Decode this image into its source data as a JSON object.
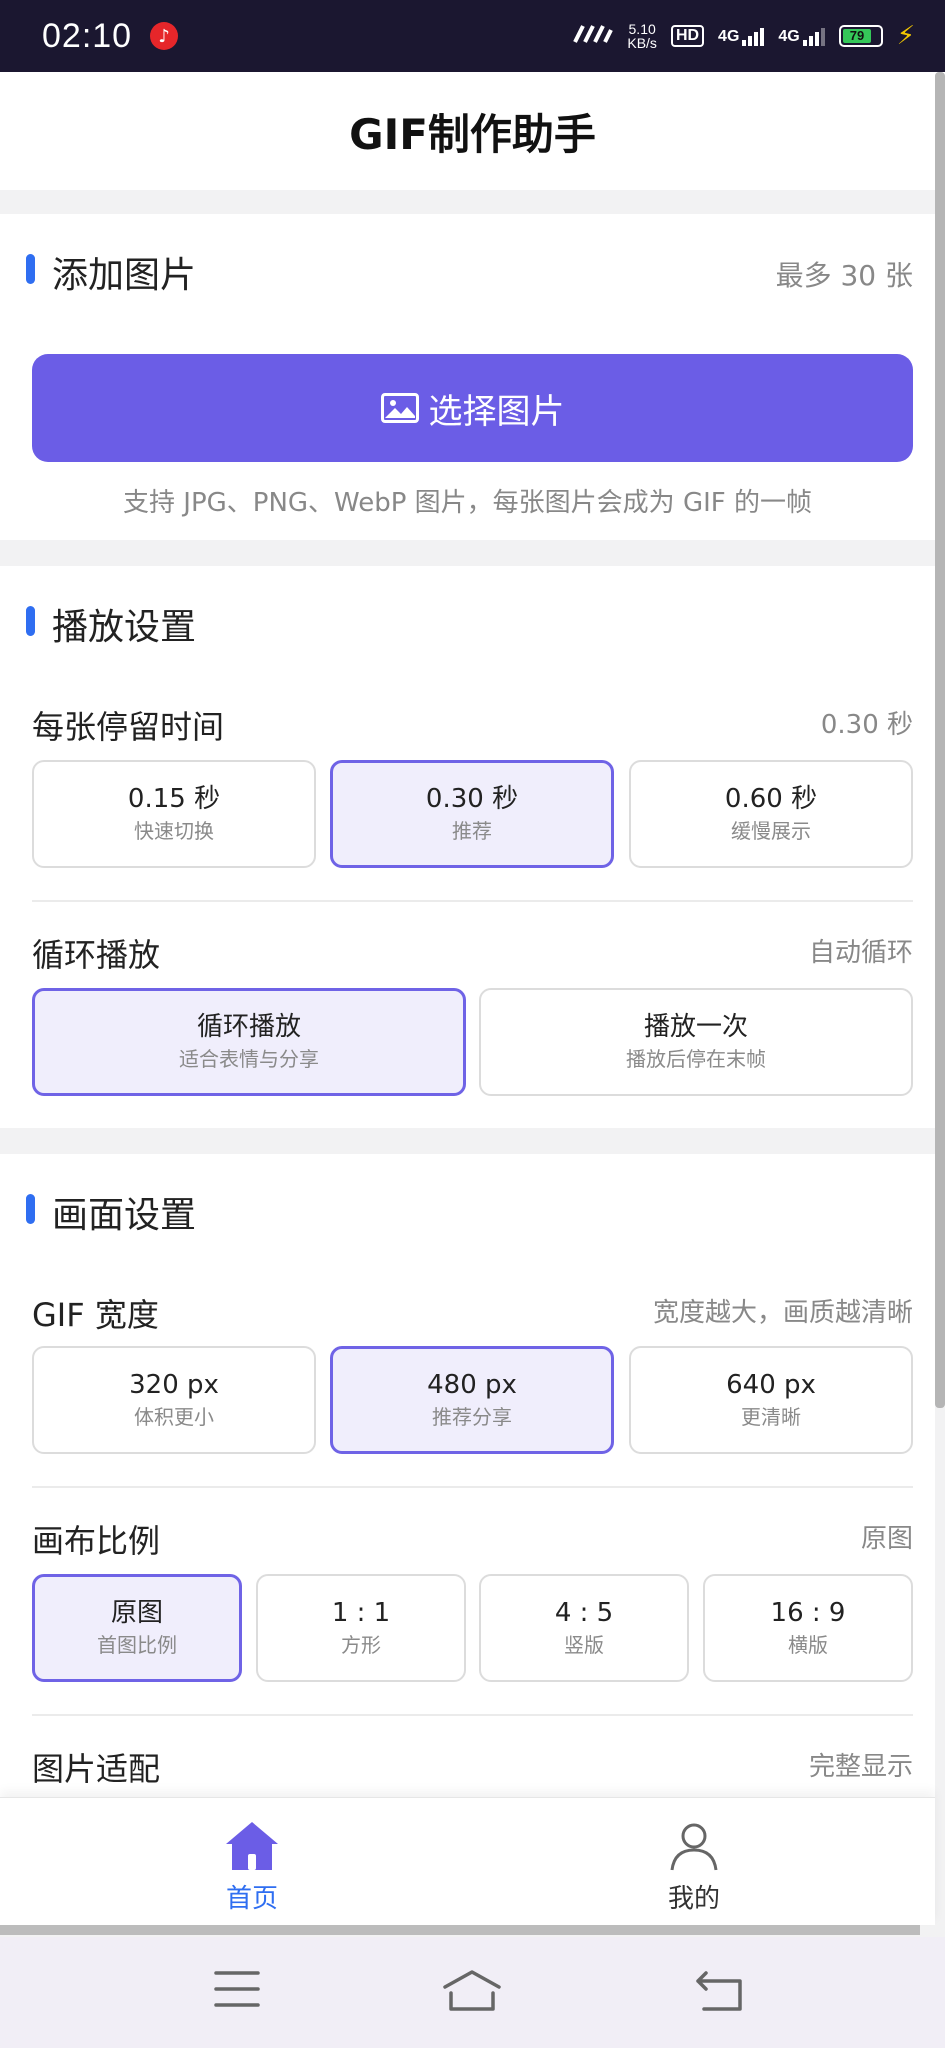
{
  "status_bar": {
    "time": "02:10",
    "net_speed": "5.10",
    "net_speed_unit": "KB/s",
    "hd_label": "HD",
    "signal1": "4G",
    "signal2": "4G",
    "battery": "79"
  },
  "header": {
    "title": "GIF制作助手"
  },
  "add_images": {
    "title": "添加图片",
    "hint": "最多 30 张",
    "button_label": "选择图片",
    "support_text": "支持 JPG、PNG、WebP 图片，每张图片会成为 GIF 的一帧"
  },
  "playback": {
    "title": "播放设置",
    "duration": {
      "label": "每张停留时间",
      "value": "0.30 秒",
      "options": [
        {
          "main": "0.15 秒",
          "sub": "快速切换",
          "selected": false
        },
        {
          "main": "0.30 秒",
          "sub": "推荐",
          "selected": true
        },
        {
          "main": "0.60 秒",
          "sub": "缓慢展示",
          "selected": false
        }
      ]
    },
    "loop": {
      "label": "循环播放",
      "value": "自动循环",
      "options": [
        {
          "main": "循环播放",
          "sub": "适合表情与分享",
          "selected": true
        },
        {
          "main": "播放一次",
          "sub": "播放后停在末帧",
          "selected": false
        }
      ]
    }
  },
  "canvas": {
    "title": "画面设置",
    "width": {
      "label": "GIF 宽度",
      "value": "宽度越大，画质越清晰",
      "options": [
        {
          "main": "320 px",
          "sub": "体积更小",
          "selected": false
        },
        {
          "main": "480 px",
          "sub": "推荐分享",
          "selected": true
        },
        {
          "main": "640 px",
          "sub": "更清晰",
          "selected": false
        }
      ]
    },
    "ratio": {
      "label": "画布比例",
      "value": "原图",
      "options": [
        {
          "main": "原图",
          "sub": "首图比例",
          "selected": true
        },
        {
          "main": "1 : 1",
          "sub": "方形",
          "selected": false
        },
        {
          "main": "4 : 5",
          "sub": "竖版",
          "selected": false
        },
        {
          "main": "16 : 9",
          "sub": "横版",
          "selected": false
        }
      ]
    },
    "fit": {
      "label": "图片适配",
      "value": "完整显示"
    }
  },
  "bottom_nav": {
    "home": "首页",
    "mine": "我的"
  },
  "colors": {
    "accent": "#6b5de6",
    "blue": "#2f6ef1",
    "selected_bg": "#f0eefc"
  }
}
